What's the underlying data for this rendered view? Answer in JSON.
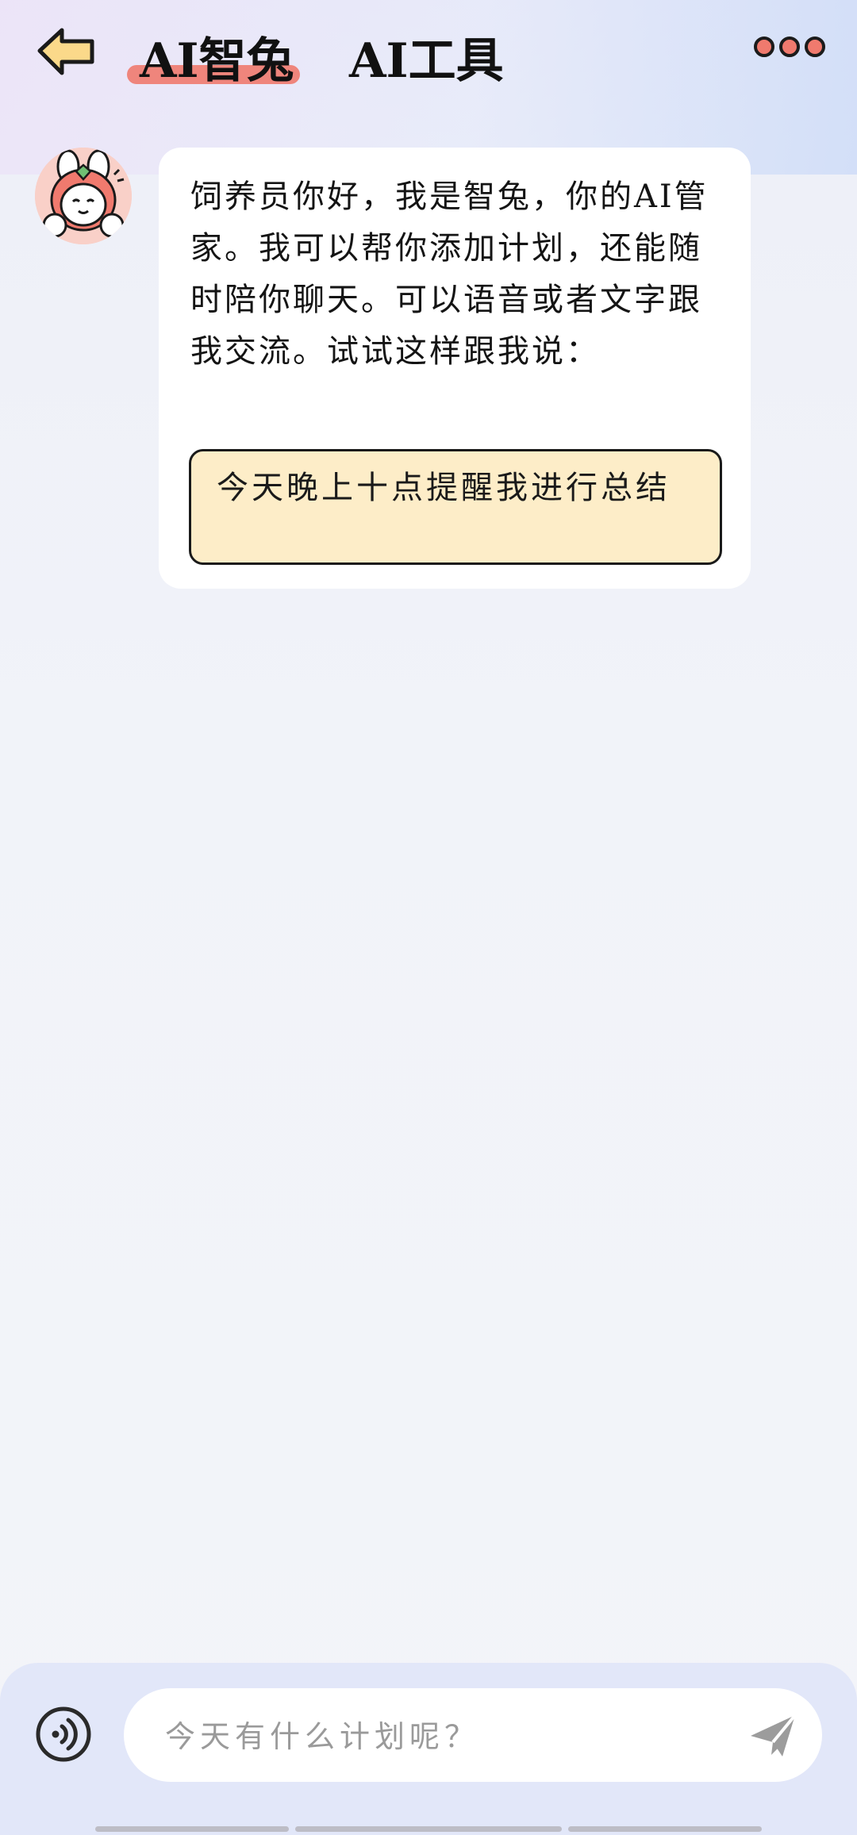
{
  "header": {
    "back_icon": "arrow-left-icon",
    "tabs": [
      {
        "label": "AI智兔",
        "active": true
      },
      {
        "label": "AI工具",
        "active": false
      }
    ],
    "more_icon": "more-dots-icon",
    "accent_color": "#f07a6e"
  },
  "chat": {
    "assistant_avatar": "rabbit-avatar-icon",
    "message_text": "饲养员你好，我是智兔，你的AI管家。我可以帮你添加计划，还能随时陪你聊天。可以语音或者文字跟我交流。试试这样跟我说：",
    "suggestion": "今天晚上十点提醒我进行总结",
    "suggestion_color": "#fdedc8"
  },
  "input_bar": {
    "voice_icon": "voice-input-icon",
    "placeholder": "今天有什么计划呢？",
    "send_icon": "send-icon"
  }
}
